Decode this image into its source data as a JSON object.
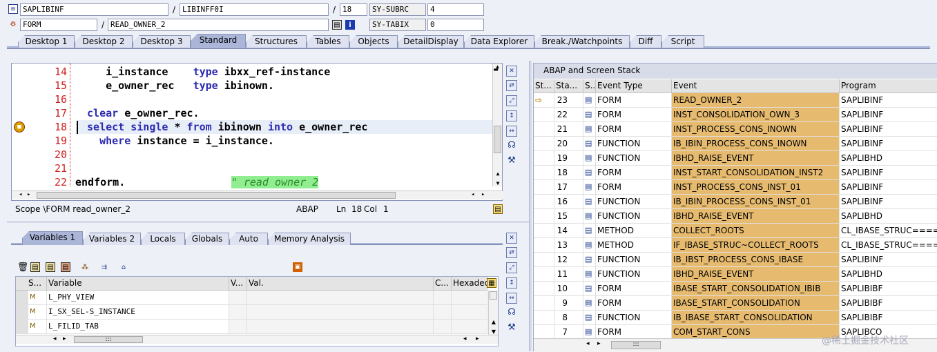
{
  "topbar": {
    "row1": {
      "program": "SAPLIBINF",
      "include": "LIBINFF0I",
      "line": "18",
      "sysvar_label": "SY-SUBRC",
      "sysvar_value": "4"
    },
    "row2": {
      "type": "FORM",
      "name": "READ_OWNER_2",
      "sysvar_label": "SY-TABIX",
      "sysvar_value": "0"
    }
  },
  "main_tabs": [
    "Desktop 1",
    "Desktop 2",
    "Desktop 3",
    "Standard",
    "Structures",
    "Tables",
    "Objects",
    "DetailDisplay",
    "Data Explorer",
    "Break./Watchpoints",
    "Diff",
    "Script"
  ],
  "editor": {
    "lines": [
      {
        "no": "14",
        "text": "    i_instance    type ibxx_ref-instance"
      },
      {
        "no": "15",
        "text": "    e_owner_rec   type ibinown."
      },
      {
        "no": "16",
        "text": ""
      },
      {
        "no": "17",
        "text": " clear e_owner_rec."
      },
      {
        "no": "18",
        "text": " select single * from ibinown into e_owner_rec"
      },
      {
        "no": "19",
        "text": "   where instance = i_instance."
      },
      {
        "no": "20",
        "text": ""
      },
      {
        "no": "21",
        "text": ""
      },
      {
        "no": "22",
        "text": "endform.                 "
      }
    ],
    "comment": "\" read owner 2",
    "status": {
      "scope": "Scope \\FORM read_owner_2",
      "lang": "ABAP",
      "ln_label": "Ln",
      "ln": "18",
      "col_label": "Col",
      "col": "1"
    }
  },
  "var_tabs": [
    "Variables 1",
    "Variables 2",
    "Locals",
    "Globals",
    "Auto",
    "Memory Analysis"
  ],
  "var_table": {
    "headers": [
      "S...",
      "Variable",
      "V...",
      "Val.",
      "C...",
      "Hexadec"
    ],
    "rows": [
      {
        "name": "L_PHY_VIEW"
      },
      {
        "name": "I_SX_SEL-S_INSTANCE"
      },
      {
        "name": "L_FILID_TAB"
      }
    ]
  },
  "stack": {
    "title": "ABAP and Screen Stack",
    "headers": [
      "St...",
      "Sta...",
      "S...",
      "Event Type",
      "Event",
      "Program"
    ],
    "rows": [
      {
        "level": "23",
        "type": "FORM",
        "event": "READ_OWNER_2",
        "program": "SAPLIBINF",
        "current": true
      },
      {
        "level": "22",
        "type": "FORM",
        "event": "INST_CONSOLIDATION_OWN_3",
        "program": "SAPLIBINF"
      },
      {
        "level": "21",
        "type": "FORM",
        "event": "INST_PROCESS_CONS_INOWN",
        "program": "SAPLIBINF"
      },
      {
        "level": "20",
        "type": "FUNCTION",
        "event": "IB_IBIN_PROCESS_CONS_INOWN",
        "program": "SAPLIBINF"
      },
      {
        "level": "19",
        "type": "FUNCTION",
        "event": "IBHD_RAISE_EVENT",
        "program": "SAPLIBHD"
      },
      {
        "level": "18",
        "type": "FORM",
        "event": "INST_START_CONSOLIDATION_INST2",
        "program": "SAPLIBINF"
      },
      {
        "level": "17",
        "type": "FORM",
        "event": "INST_PROCESS_CONS_INST_01",
        "program": "SAPLIBINF"
      },
      {
        "level": "16",
        "type": "FUNCTION",
        "event": "IB_IBIN_PROCESS_CONS_INST_01",
        "program": "SAPLIBINF"
      },
      {
        "level": "15",
        "type": "FUNCTION",
        "event": "IBHD_RAISE_EVENT",
        "program": "SAPLIBHD"
      },
      {
        "level": "14",
        "type": "METHOD",
        "event": "COLLECT_ROOTS",
        "program": "CL_IBASE_STRUC====="
      },
      {
        "level": "13",
        "type": "METHOD",
        "event": "IF_IBASE_STRUC~COLLECT_ROOTS",
        "program": "CL_IBASE_STRUC====="
      },
      {
        "level": "12",
        "type": "FUNCTION",
        "event": "IB_IBST_PROCESS_CONS_IBASE",
        "program": "SAPLIBINF"
      },
      {
        "level": "11",
        "type": "FUNCTION",
        "event": "IBHD_RAISE_EVENT",
        "program": "SAPLIBHD"
      },
      {
        "level": "10",
        "type": "FORM",
        "event": "IBASE_START_CONSOLIDATION_IBIB",
        "program": "SAPLIBIBF"
      },
      {
        "level": "9",
        "type": "FORM",
        "event": "IBASE_START_CONSOLIDATION",
        "program": "SAPLIBIBF"
      },
      {
        "level": "8",
        "type": "FUNCTION",
        "event": "IB_IBASE_START_CONSOLIDATION",
        "program": "SAPLIBIBF"
      },
      {
        "level": "7",
        "type": "FORM",
        "event": "COM_START_CONS",
        "program": "SAPLIBCO"
      }
    ]
  },
  "watermark": "@稀土掘金技术社区",
  "colors": {
    "accent": "#aab5d8",
    "event_bg": "#e6bb70",
    "line_no": "#d12020",
    "keyword": "#2b2bb0"
  }
}
